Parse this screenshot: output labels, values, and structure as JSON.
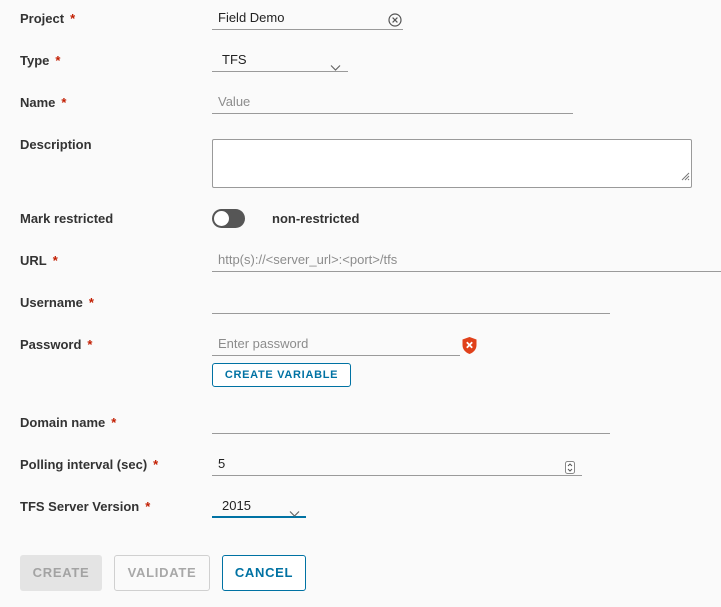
{
  "form": {
    "project": {
      "label": "Project",
      "required": "*",
      "value": "Field Demo"
    },
    "type": {
      "label": "Type",
      "required": "*",
      "value": "TFS"
    },
    "name": {
      "label": "Name",
      "required": "*",
      "placeholder": "Value"
    },
    "description": {
      "label": "Description"
    },
    "mark_restricted": {
      "label": "Mark restricted",
      "state_text": "non-restricted",
      "on": false
    },
    "url": {
      "label": "URL",
      "required": "*",
      "placeholder": "http(s)://<server_url>:<port>/tfs"
    },
    "username": {
      "label": "Username",
      "required": "*"
    },
    "password": {
      "label": "Password",
      "required": "*",
      "placeholder": "Enter password",
      "create_variable": "CREATE VARIABLE"
    },
    "domain": {
      "label": "Domain name",
      "required": "*"
    },
    "polling": {
      "label": "Polling interval (sec)",
      "required": "*",
      "value": "5"
    },
    "tfs_version": {
      "label": "TFS Server Version",
      "required": "*",
      "value": "2015"
    }
  },
  "buttons": {
    "create": "CREATE",
    "validate": "VALIDATE",
    "cancel": "CANCEL"
  },
  "colors": {
    "required": "#c21d00",
    "primary": "#0072a3",
    "error_shield": "#e0411b",
    "toggle_off": "#565656"
  },
  "icons": {
    "clear": "circle-x-icon",
    "dropdown": "chevron-down-icon",
    "stepper": "spinner-icon",
    "shield": "shield-error-icon"
  }
}
